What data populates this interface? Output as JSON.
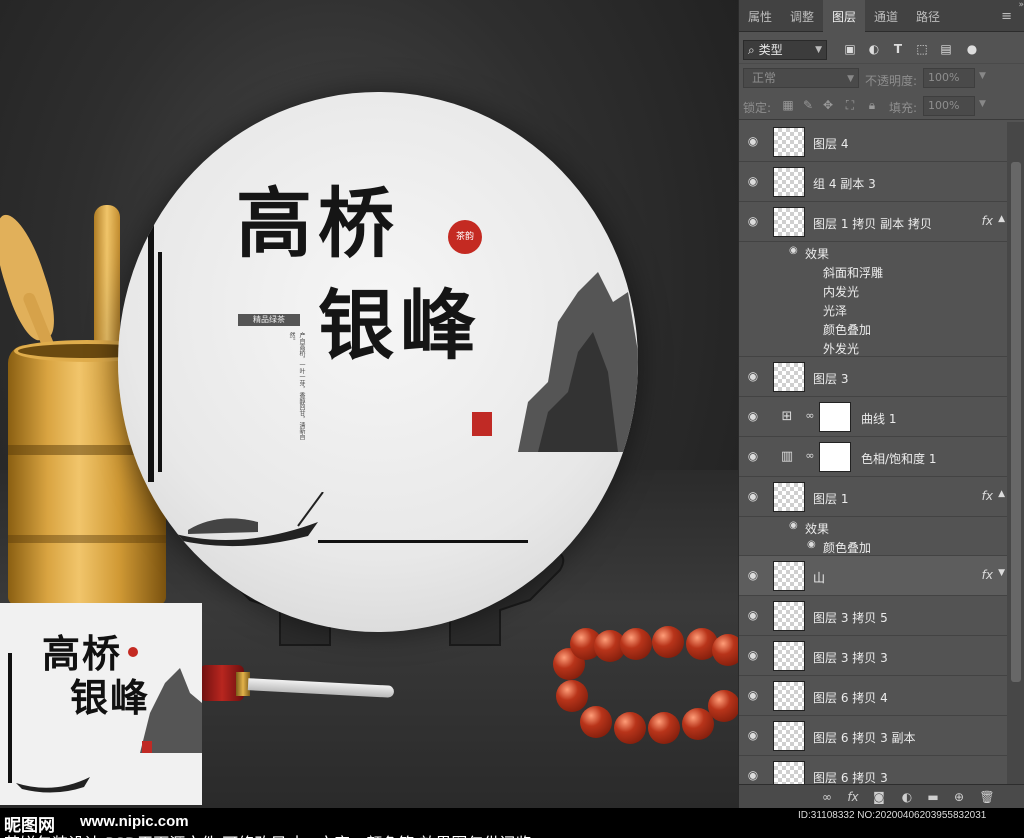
{
  "scene": {
    "cake": {
      "title_line1": "高桥",
      "title_line2": "银峰",
      "seal_text": "茶韵",
      "label": "精品绿茶",
      "body": "产自高桥，一叶一芽，香醇回甘，清新自然。"
    },
    "thumbnail": {
      "title_line1": "高桥",
      "title_line2": "银峰"
    }
  },
  "bottom_bar": {
    "site_name": "昵图网",
    "site_url": "www.nipic.com",
    "image_id": "ID:31108332 NO:20200406203955832031",
    "caption": "茶饼包装设计  PSD平面源文件  可修改尺寸、文字、颜色等  效果图仅供阅览"
  },
  "panel": {
    "tabs": [
      {
        "label": "属性"
      },
      {
        "label": "调整"
      },
      {
        "label": "图层"
      },
      {
        "label": "通道"
      },
      {
        "label": "路径"
      }
    ],
    "filter": {
      "value": "类型"
    },
    "blend": {
      "value": "正常"
    },
    "opacity": {
      "label": "不透明度:",
      "value": "100%"
    },
    "lock": {
      "label": "锁定:"
    },
    "fill": {
      "label": "填充:",
      "value": "100%"
    },
    "layers": [
      {
        "name": "图层 4"
      },
      {
        "name": "组 4 副本 3"
      },
      {
        "name": "图层 1 拷贝 副本 拷贝",
        "fx": "fx",
        "effects_label": "效果",
        "effects": [
          "斜面和浮雕",
          "内发光",
          "光泽",
          "颜色叠加",
          "外发光"
        ]
      },
      {
        "name": "图层 3"
      },
      {
        "name": "曲线 1"
      },
      {
        "name": "色相/饱和度 1"
      },
      {
        "name": "图层 1",
        "fx": "fx",
        "effects_label": "效果",
        "effects": [
          "颜色叠加"
        ]
      },
      {
        "name": "山",
        "fx": "fx"
      },
      {
        "name": "图层 3 拷贝 5"
      },
      {
        "name": "图层 3 拷贝 3"
      },
      {
        "name": "图层 6 拷贝 4"
      },
      {
        "name": "图层 6 拷贝 3 副本"
      },
      {
        "name": "图层 6 拷贝 3"
      }
    ]
  },
  "icons": {
    "eye": "eye-icon",
    "link": "link-icon",
    "fx": "fx-icon"
  }
}
